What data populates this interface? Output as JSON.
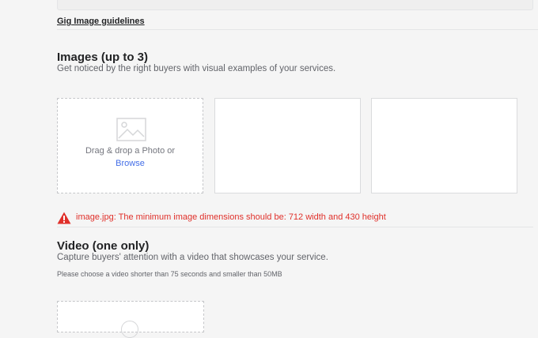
{
  "guidelines": {
    "link_label": "Gig Image guidelines"
  },
  "images": {
    "title": "Images (up to 3)",
    "description": "Get noticed by the right buyers with visual examples of your services.",
    "upload": {
      "drop_label": "Drag & drop a Photo or",
      "browse_label": "Browse",
      "icon": "image-icon"
    },
    "error": {
      "text": "image.jpg: The minimum image dimensions should be: 712 width and 430 height",
      "icon": "warning-icon",
      "color": "#e0302a"
    }
  },
  "video": {
    "title": "Video (one only)",
    "description": "Capture buyers' attention with a video that showcases your service.",
    "note": "Please choose a video shorter than 75 seconds and smaller than 50MB"
  },
  "colors": {
    "link": "#446ee7",
    "error": "#e0302a",
    "background": "#f5f5f5"
  }
}
